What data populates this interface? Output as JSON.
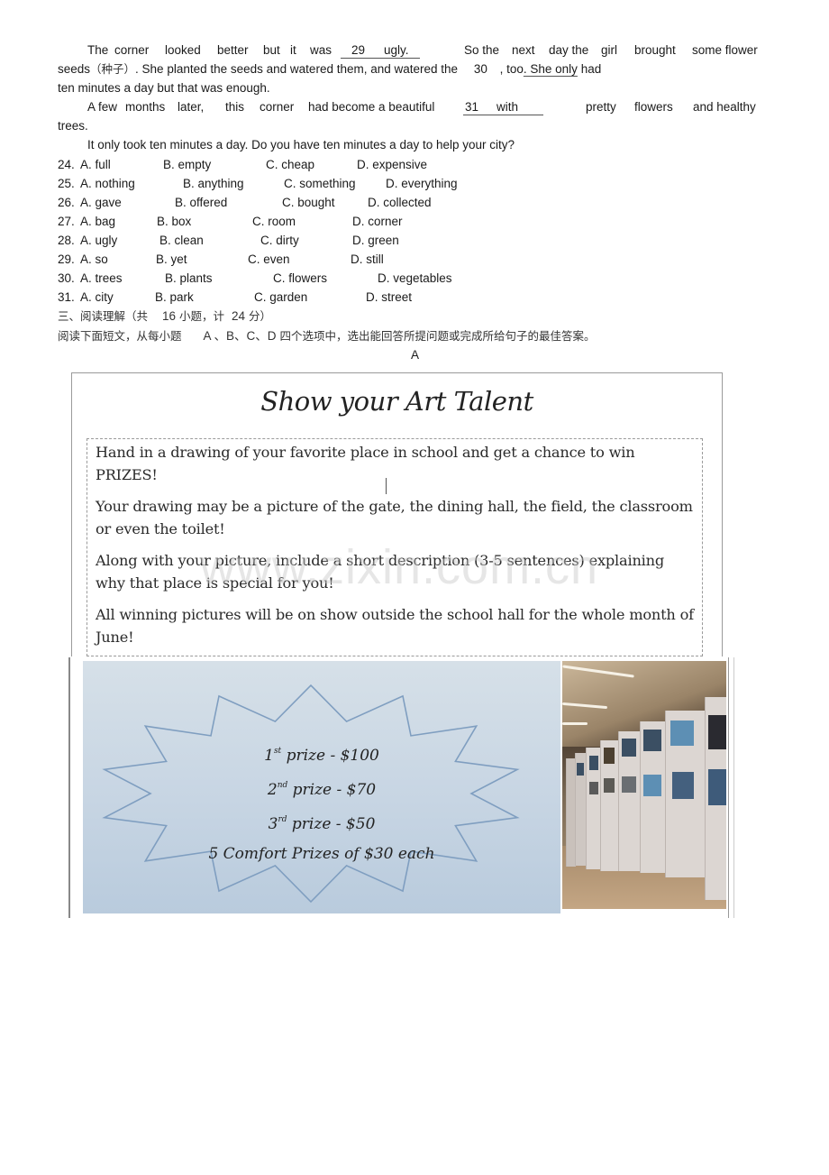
{
  "passage": {
    "p1_l1": {
      "words": [
        "The",
        "corner",
        "looked",
        "better",
        "but",
        "it",
        "was"
      ],
      "blank": "29",
      "blank_tail": "ugly.",
      "rest": [
        "So the",
        "next",
        "day the",
        "girl",
        "brought",
        "some flower"
      ]
    },
    "p1_l2": {
      "a": "seeds",
      "cn": "（种子）",
      "b": ". She planted the seeds and watered them, and watered the",
      "blank": "30",
      "c": ", too",
      "d": ". She only",
      "e": " had"
    },
    "p1_l3": "ten minutes a day but that was enough.",
    "p2_l1": {
      "words": [
        "A few",
        "months",
        "later,",
        "this",
        "corner",
        "had become a beautiful"
      ],
      "blank": "31",
      "blank_tail": "with",
      "rest": [
        "pretty",
        "flowers",
        "and healthy"
      ]
    },
    "p2_l2": "trees.",
    "p3": "It only took ten minutes a day. Do you have ten minutes a day to help your city?"
  },
  "questions": [
    {
      "num": "24.",
      "a": "A. full",
      "b": "B. empty",
      "c": "C. cheap",
      "d": "D. expensive"
    },
    {
      "num": "25.",
      "a": "A. nothing",
      "b": "B. anything",
      "c": "C. something",
      "d": "D. everything"
    },
    {
      "num": "26.",
      "a": "A. gave",
      "b": "B. offered",
      "c": "C. bought",
      "d": "D. collected"
    },
    {
      "num": "27.",
      "a": "A. bag",
      "b": "B. box",
      "c": "C. room",
      "d": "D. corner"
    },
    {
      "num": "28.",
      "a": "A. ugly",
      "b": "B. clean",
      "c": "C. dirty",
      "d": "D. green"
    },
    {
      "num": "29.",
      "a": "A. so",
      "b": "B. yet",
      "c": "C. even",
      "d": "D. still"
    },
    {
      "num": "30.",
      "a": "A. trees",
      "b": "B. plants",
      "c": "C. flowers",
      "d": "D. vegetables"
    },
    {
      "num": "31.",
      "a": "A. city",
      "b": "B. park",
      "c": "C. garden",
      "d": "D. street"
    }
  ],
  "section": {
    "heading_a": "三、阅读理解（共",
    "heading_count": "16",
    "heading_b": "小题，计",
    "heading_score": "24",
    "heading_c": "分）",
    "instr_a": "阅读下面短文，从每小题",
    "instr_letters": "A 、B、C、D",
    "instr_b": "四个选项中，选出能回答所提问题或完成所给句子的最佳答案。",
    "passage_label": "A"
  },
  "poster": {
    "title": "Show your Art Talent",
    "paragraphs": [
      "Hand in a drawing of your favorite place in school and get a chance to win PRIZES!",
      "Your drawing may be a picture of the gate, the dining hall, the field, the classroom or even the toilet!",
      "Along with your picture, include a short description (3-5 sentences) explaining why that place is special for you!",
      "All winning pictures will be on show outside the school hall for the whole month of June!"
    ],
    "watermark": "www.zixin.com.cn",
    "prizes": [
      {
        "rank": "1",
        "suffix": "st",
        "text": " prize - $100"
      },
      {
        "rank": "2",
        "suffix": "nd",
        "text": " prize - $70"
      },
      {
        "rank": "3",
        "suffix": "rd",
        "text": " prize - $50"
      }
    ],
    "comfort": "5 Comfort Prizes of $30 each",
    "photo_alt": "exhibition hall with displayed pictures"
  }
}
